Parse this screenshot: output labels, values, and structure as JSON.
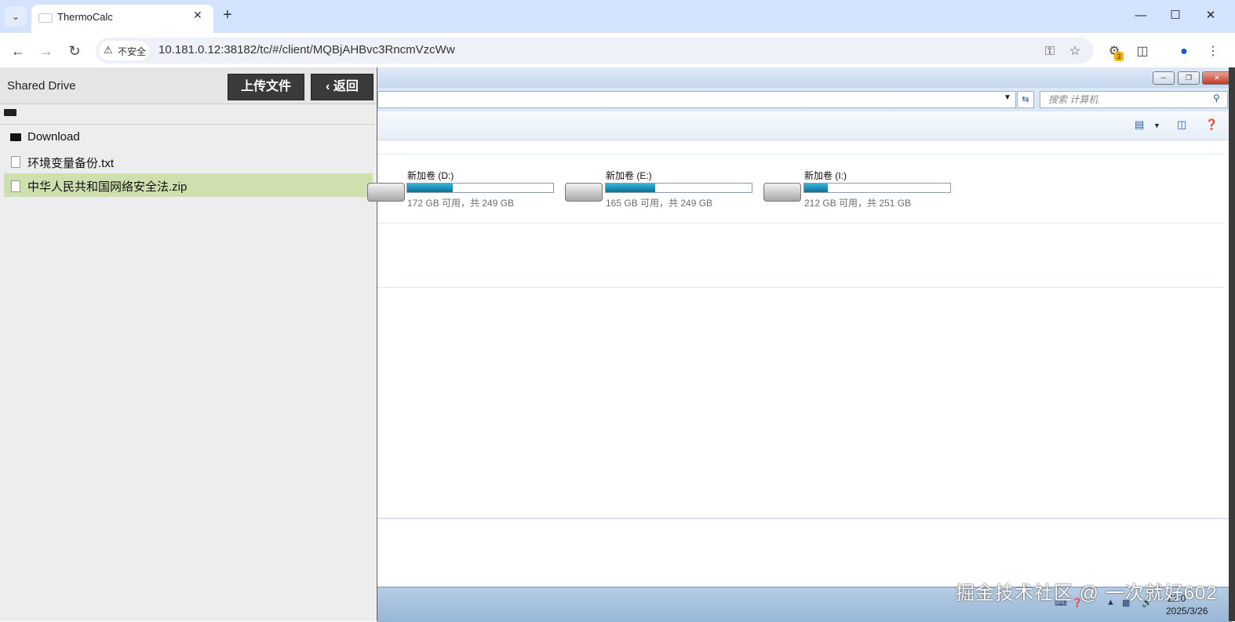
{
  "browser": {
    "tab_title": "ThermoCalc",
    "security_label": "不安全",
    "url": "10.181.0.12:38182/tc/#/client/MQBjAHBvc3RncmVzcWw",
    "extension_badge": "3"
  },
  "file_panel": {
    "title": "Shared Drive",
    "upload_button": "上传文件",
    "back_button": "返回",
    "items": [
      {
        "name": "Download",
        "type": "folder"
      },
      {
        "name": "环境变量备份.txt",
        "type": "file"
      },
      {
        "name": "中华人民共和国网络安全法.zip",
        "type": "file",
        "selected": true
      }
    ]
  },
  "explorer": {
    "search_placeholder": "搜索 计算机",
    "drives": [
      {
        "name": "新加卷 (D:)",
        "size": "172 GB 可用，共 249 GB",
        "used_fraction": 0.31
      },
      {
        "name": "新加卷 (E:)",
        "size": "165 GB 可用，共 249 GB",
        "used_fraction": 0.34
      },
      {
        "name": "新加卷 (I:)",
        "size": "212 GB 可用，共 251 GB",
        "used_fraction": 0.16
      }
    ]
  },
  "taskbar": {
    "time": "22:0",
    "date": "2025/3/26"
  },
  "watermark": "掘金技术社区 @ 一次就好602",
  "colors": {
    "selected_row": "#cde0ad",
    "dark_button": "#3a3a3a",
    "tab_strip": "#d3e3fd"
  }
}
